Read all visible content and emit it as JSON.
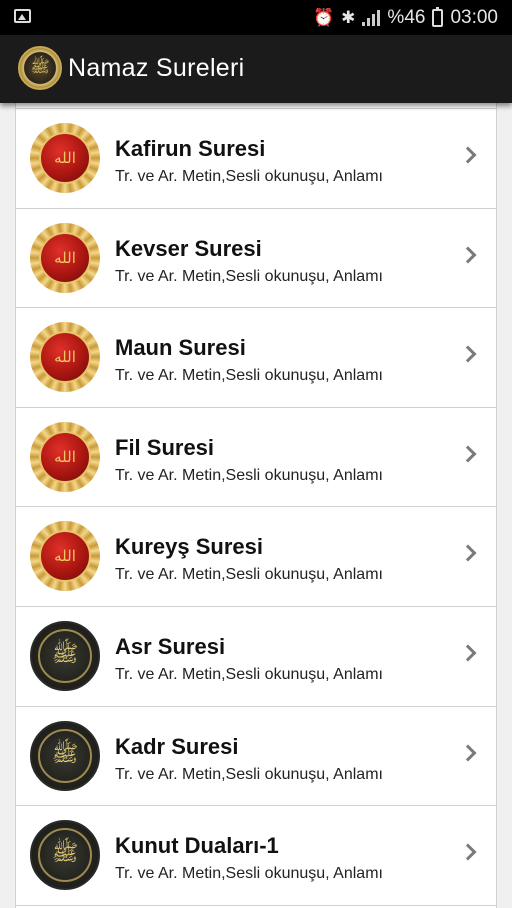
{
  "status_bar": {
    "battery_percent": "%46",
    "time": "03:00",
    "icons": [
      "image-icon",
      "alarm-icon",
      "bluetooth-icon",
      "signal-icon",
      "battery-icon"
    ]
  },
  "app_bar": {
    "title": "Namaz Sureleri",
    "logo_icon": "calligraphy-seal-icon"
  },
  "colors": {
    "status_bar_bg": "#000000",
    "app_bar_bg": "#1b1b1b",
    "list_bg": "#ffffff",
    "gold": "#c99a3a",
    "red": "#b01812"
  },
  "items": [
    {
      "title": "Kafirun Suresi",
      "subtitle": "Tr. ve Ar. Metin,Sesli okunuşu, Anlamı",
      "icon": "gear-medallion-icon"
    },
    {
      "title": "Kevser Suresi",
      "subtitle": "Tr. ve Ar. Metin,Sesli okunuşu, Anlamı",
      "icon": "gear-medallion-icon"
    },
    {
      "title": "Maun Suresi",
      "subtitle": "Tr. ve Ar. Metin,Sesli okunuşu, Anlamı",
      "icon": "gear-medallion-icon"
    },
    {
      "title": "Fil Suresi",
      "subtitle": "Tr. ve Ar. Metin,Sesli okunuşu, Anlamı",
      "icon": "gear-medallion-icon"
    },
    {
      "title": "Kureyş Suresi",
      "subtitle": "Tr. ve Ar. Metin,Sesli okunuşu, Anlamı",
      "icon": "gear-medallion-icon"
    },
    {
      "title": "Asr Suresi",
      "subtitle": "Tr. ve Ar. Metin,Sesli okunuşu, Anlamı",
      "icon": "calligraphy-seal-icon"
    },
    {
      "title": "Kadr Suresi",
      "subtitle": "Tr. ve Ar. Metin,Sesli okunuşu, Anlamı",
      "icon": "calligraphy-seal-icon"
    },
    {
      "title": "Kunut Duaları-1",
      "subtitle": "Tr. ve Ar. Metin,Sesli okunuşu, Anlamı",
      "icon": "calligraphy-seal-icon"
    }
  ]
}
